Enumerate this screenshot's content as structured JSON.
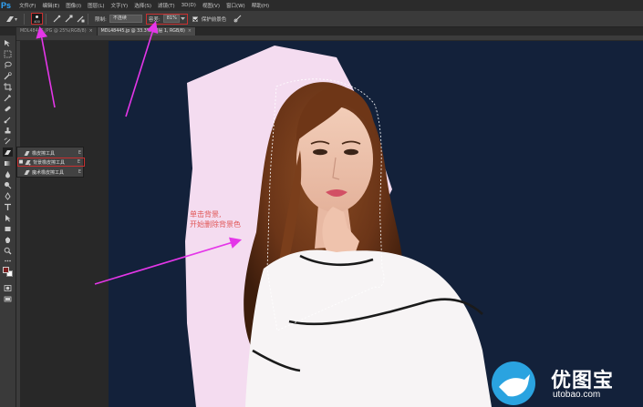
{
  "app": {
    "logo": "Ps"
  },
  "menu": {
    "items": [
      "文件(F)",
      "编辑(E)",
      "图像(I)",
      "图层(L)",
      "文字(Y)",
      "选择(S)",
      "滤镜(T)",
      "3D(D)",
      "视图(V)",
      "窗口(W)",
      "帮助(H)"
    ]
  },
  "options": {
    "brush_size": "400",
    "limits_label": "限制:",
    "limits_value": "不连续",
    "tolerance_label": "容差:",
    "tolerance_value": "81%",
    "protect_label": "保护前景色",
    "protect_checked": true
  },
  "tabs": [
    {
      "label": "MDL48445.JPG @ 25%(RGB/8)",
      "active": false
    },
    {
      "label": "MDL48445.jp @ 33.3% (图层 1, RGB/8)",
      "active": true
    }
  ],
  "flyout": {
    "items": [
      {
        "label": "橡皮擦工具",
        "key": "E",
        "icon": "eraser-icon",
        "selected": false
      },
      {
        "label": "背景橡皮擦工具",
        "key": "E",
        "icon": "background-eraser-icon",
        "selected": true
      },
      {
        "label": "魔术橡皮擦工具",
        "key": "E",
        "icon": "magic-eraser-icon",
        "selected": false
      }
    ]
  },
  "annotation": {
    "line1": "单击背景,",
    "line2": "开始删除背景色"
  },
  "watermark": {
    "brand": "优图宝",
    "url": "utobao.com"
  },
  "colors": {
    "accent_arrow": "#e436e8",
    "canvas_bg": "#13213a",
    "erased_region": "#f4dcf0",
    "annotation_text": "#e05656",
    "highlight_box": "#c83030"
  }
}
